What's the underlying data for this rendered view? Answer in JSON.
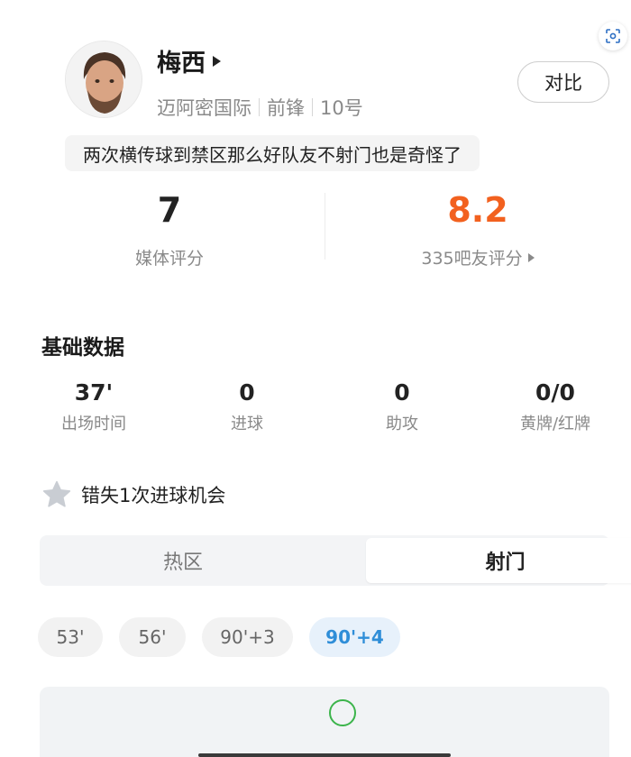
{
  "player": {
    "name": "梅西",
    "team": "迈阿密国际",
    "position": "前锋",
    "number": "10号",
    "comment": "两次横传球到禁区那么好队友不射门也是奇怪了"
  },
  "buttons": {
    "compare": "对比"
  },
  "ratings": {
    "media_value": "7",
    "media_label": "媒体评分",
    "fan_value": "8.2",
    "fan_label": "335吧友评分"
  },
  "basic_stats": {
    "title": "基础数据",
    "items": [
      {
        "value": "37'",
        "label": "出场时间"
      },
      {
        "value": "0",
        "label": "进球"
      },
      {
        "value": "0",
        "label": "助攻"
      },
      {
        "value": "0/0",
        "label": "黄牌/红牌"
      }
    ]
  },
  "highlight": {
    "text": "错失1次进球机会",
    "icon": "star-icon"
  },
  "tabs": [
    {
      "label": "热区",
      "active": false
    },
    {
      "label": "射门",
      "active": true
    }
  ],
  "shot_times": [
    {
      "label": "53'",
      "active": false
    },
    {
      "label": "56'",
      "active": false
    },
    {
      "label": "90'+3",
      "active": false
    },
    {
      "label": "90'+4",
      "active": true
    }
  ],
  "colors": {
    "fan_rating": "#f2611f",
    "active_chip_text": "#2f8ed8",
    "active_chip_bg": "#e7f1fb",
    "shot_marker": "#3cb44b"
  }
}
